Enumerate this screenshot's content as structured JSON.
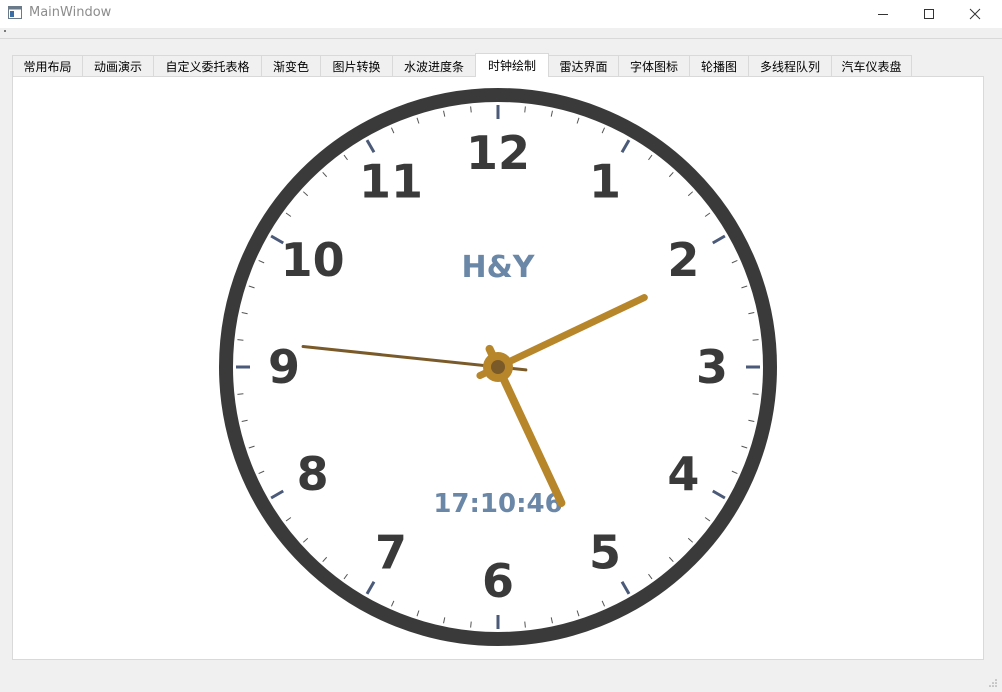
{
  "window": {
    "title": "MainWindow"
  },
  "tabs": [
    {
      "label": "常用布局",
      "active": false
    },
    {
      "label": "动画演示",
      "active": false
    },
    {
      "label": "自定义委托表格",
      "active": false
    },
    {
      "label": "渐变色",
      "active": false
    },
    {
      "label": "图片转换",
      "active": false
    },
    {
      "label": "水波进度条",
      "active": false
    },
    {
      "label": "时钟绘制",
      "active": true
    },
    {
      "label": "雷达界面",
      "active": false
    },
    {
      "label": "字体图标",
      "active": false
    },
    {
      "label": "轮播图",
      "active": false
    },
    {
      "label": "多线程队列",
      "active": false
    },
    {
      "label": "汽车仪表盘",
      "active": false
    }
  ],
  "clock": {
    "brand": "H&Y",
    "time_text": "17:10:46",
    "hours": 17,
    "minutes": 10,
    "seconds": 46,
    "numerals": [
      "12",
      "1",
      "2",
      "3",
      "4",
      "5",
      "6",
      "7",
      "8",
      "9",
      "10",
      "11"
    ],
    "colors": {
      "bezel": "#3a3a3a",
      "numerals": "#3a3a3a",
      "brand": "#6b87a8",
      "hour_ticks": "#4a5a78",
      "minute_ticks": "#555555",
      "hour_minute_hands": "#b8862a",
      "second_hand": "#7a5a28",
      "center_dot": "#7a5a28"
    }
  }
}
